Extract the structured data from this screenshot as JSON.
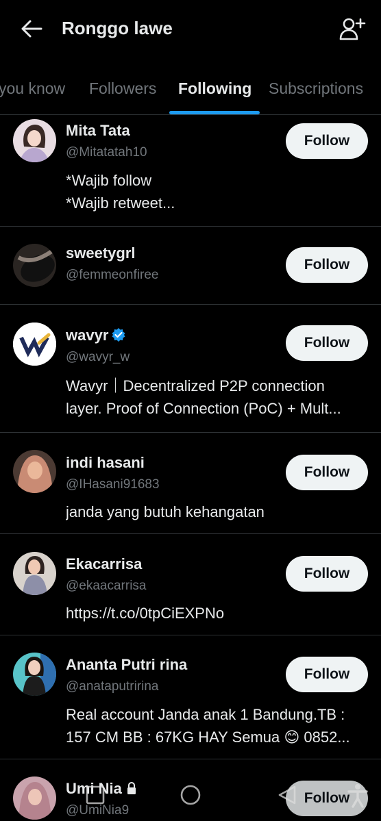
{
  "header": {
    "title": "Ronggo lawe",
    "back_icon": "arrow-left-icon",
    "add_user_icon": "add-user-icon"
  },
  "tabs": [
    {
      "label": "you know",
      "active": false
    },
    {
      "label": "Followers",
      "active": false
    },
    {
      "label": "Following",
      "active": true
    },
    {
      "label": "Subscriptions",
      "active": false
    }
  ],
  "accent_color": "#1d9bf0",
  "users": [
    {
      "name": "Mita Tata",
      "handle": "@Mitatatah10",
      "bio": [
        "*Wajib follow",
        "*Wajib retweet..."
      ],
      "button": "Follow",
      "verified": false,
      "locked": false
    },
    {
      "name": "sweetygrl",
      "handle": "@femmeonfiree",
      "bio": [],
      "button": "Follow",
      "verified": false,
      "locked": false
    },
    {
      "name": "wavyr",
      "handle": "@wavyr_w",
      "bio": [
        "Wavyr｜Decentralized P2P connection",
        "layer. Proof of Connection (PoC) + Mult..."
      ],
      "button": "Follow",
      "verified": true,
      "locked": false
    },
    {
      "name": "indi hasani",
      "handle": "@IHasani91683",
      "bio": [
        "janda yang butuh kehangatan"
      ],
      "button": "Follow",
      "verified": false,
      "locked": false
    },
    {
      "name": "Ekacarrisa",
      "handle": "@ekaacarrisa",
      "bio": [
        "https://t.co/0tpCiEXPNo"
      ],
      "button": "Follow",
      "verified": false,
      "locked": false
    },
    {
      "name": "Ananta Putri rina",
      "handle": "@anataputririna",
      "bio": [
        "Real account Janda anak 1 Bandung.TB :",
        "157 CM BB : 67KG HAY Semua 😊  0852..."
      ],
      "button": "Follow",
      "verified": false,
      "locked": false
    },
    {
      "name": "Umi Nia",
      "handle": "@UmiNia9",
      "bio": [],
      "button": "Follow",
      "verified": false,
      "locked": true
    }
  ],
  "system_nav": {
    "recents_icon": "square-recents-icon",
    "home_icon": "circle-home-icon",
    "back_icon": "triangle-back-icon",
    "accessibility_icon": "accessibility-icon"
  }
}
